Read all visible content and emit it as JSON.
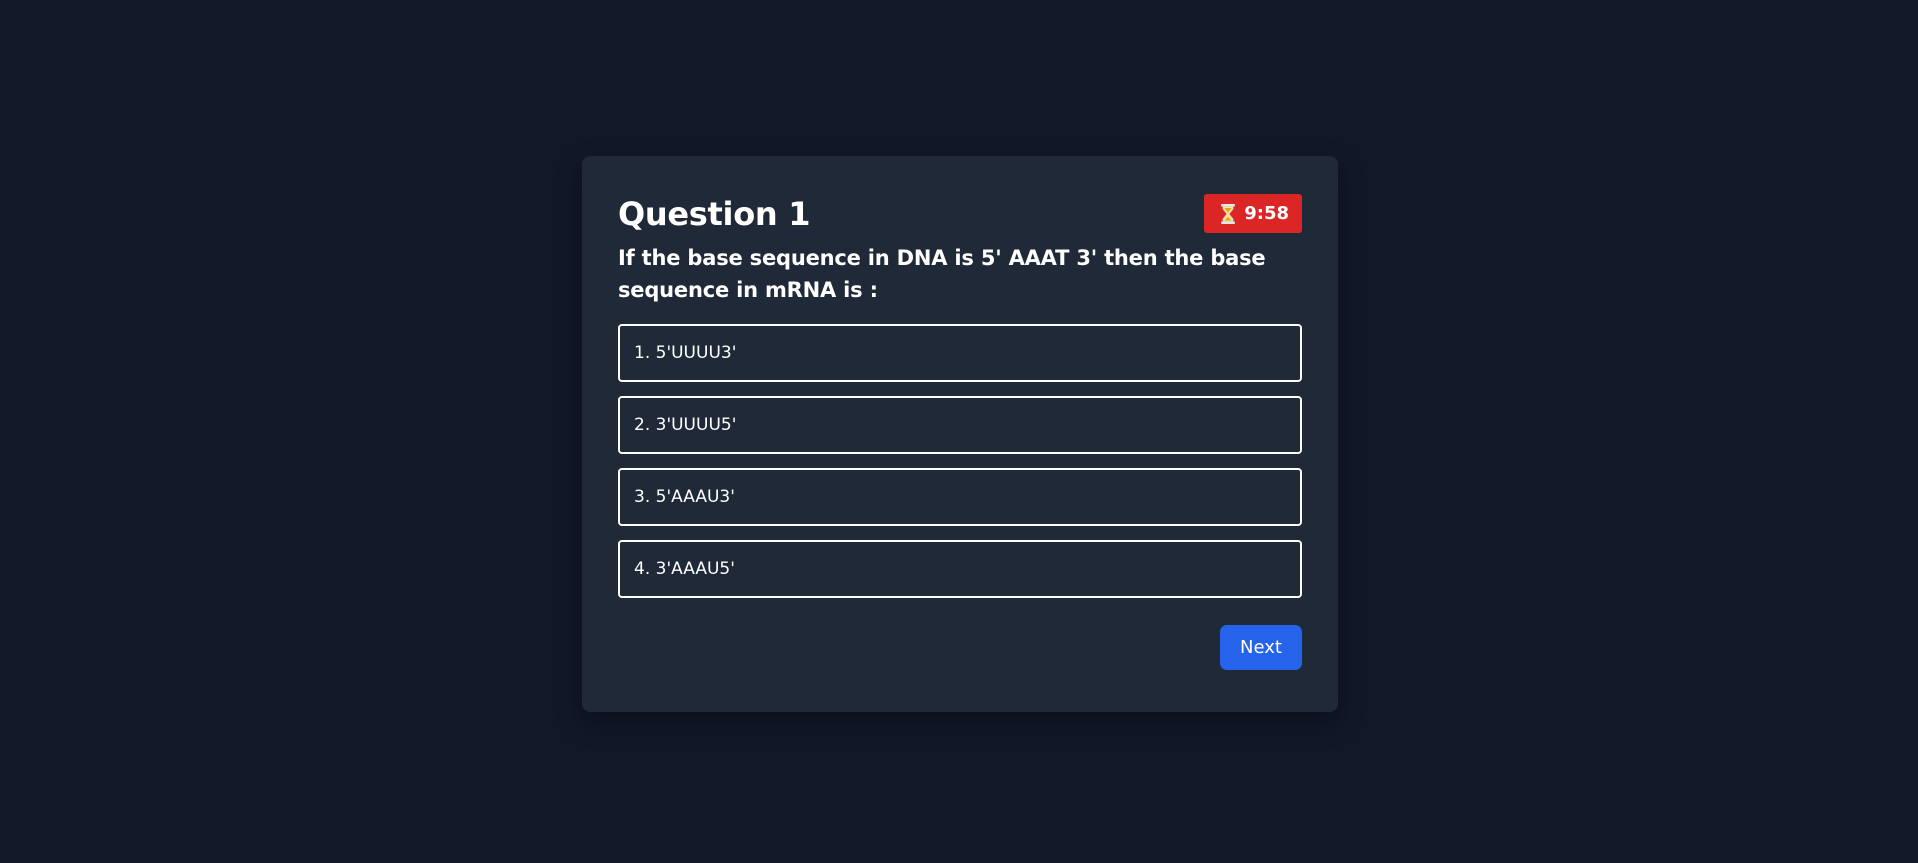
{
  "quiz": {
    "title": "Question 1",
    "timer": {
      "icon": "hourglass-icon",
      "value": "9:58",
      "color": "#dc2626"
    },
    "question_text": "If the base sequence in DNA is 5' AAAT 3' then the base sequence in mRNA is :",
    "options": [
      {
        "label": "1. 5'UUUU3'"
      },
      {
        "label": "2. 3'UUUU5'"
      },
      {
        "label": "3. 5'AAAU3'"
      },
      {
        "label": "4. 3'AAAU5'"
      }
    ],
    "next_label": "Next",
    "accent_color": "#2563eb"
  }
}
